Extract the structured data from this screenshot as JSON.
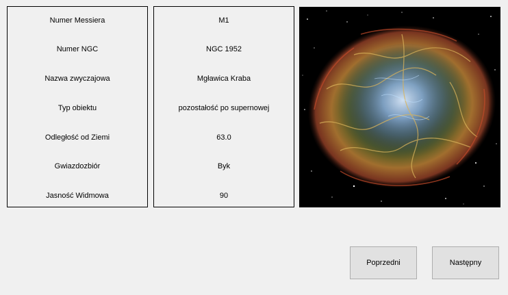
{
  "labels": {
    "messier": "Numer Messiera",
    "ngc": "Numer NGC",
    "common_name": "Nazwa zwyczajowa",
    "object_type": "Typ obiektu",
    "distance": "Odległość od Ziemi",
    "constellation": "Gwiazdozbiór",
    "magnitude": "Jasność Widmowa"
  },
  "values": {
    "messier": "M1",
    "ngc": "NGC 1952",
    "common_name": "Mgławica Kraba",
    "object_type": "pozostałość po supernowej",
    "distance": "63.0",
    "constellation": "Byk",
    "magnitude": "90"
  },
  "image": {
    "subject": "crab-nebula-image"
  },
  "buttons": {
    "previous": "Poprzedni",
    "next": "Następny"
  },
  "colors": {
    "window_bg": "#f0f0f0",
    "button_bg": "#e1e1e1",
    "button_border": "#adadad",
    "panel_border": "#000000"
  }
}
